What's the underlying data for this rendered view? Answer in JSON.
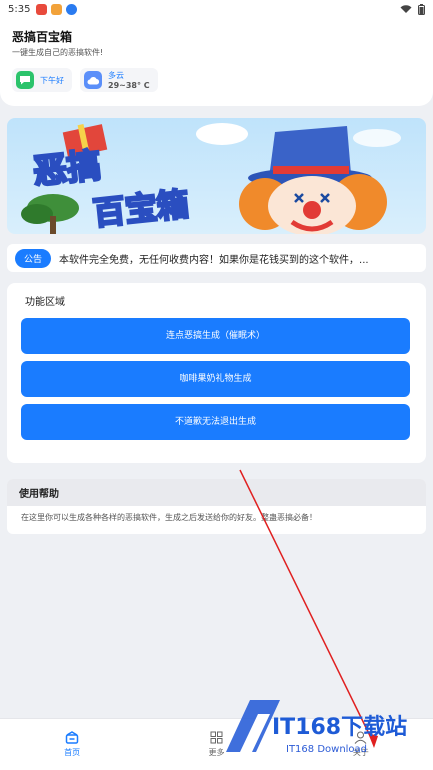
{
  "status_bar": {
    "time": "5:35"
  },
  "header": {
    "title": "恶搞百宝箱",
    "subtitle": "一键生成自己的恶搞软件!",
    "chips": [
      {
        "icon": "chat-icon",
        "color": "#2bc36b",
        "label": "下午好",
        "sub": ""
      },
      {
        "icon": "cloud-icon",
        "color": "#5b8ff9",
        "label": "多云",
        "sub": "29~38° C"
      }
    ]
  },
  "banner": {
    "line1": "恶搞",
    "line2": "百宝箱"
  },
  "notice": {
    "badge": "公告",
    "text": "本软件完全免费，无任何收费内容！如果你是花钱买到的这个软件，..."
  },
  "functions": {
    "title": "功能区域",
    "buttons": [
      "连点恶搞生成（催眠术）",
      "咖啡果奶礼物生成",
      "不道歉无法退出生成"
    ]
  },
  "help": {
    "title": "使用帮助",
    "text": "在这里你可以生成各种各样的恶搞软件，生成之后发送给你的好友。整蛊恶搞必备！"
  },
  "nav": [
    {
      "label": "首页",
      "icon": "home-icon",
      "active": true
    },
    {
      "label": "更多",
      "icon": "grid-icon",
      "active": false
    },
    {
      "label": "关于",
      "icon": "user-icon",
      "active": false
    }
  ],
  "watermark": {
    "logo": "IT168下载站",
    "sub": "IT168 Download"
  },
  "colors": {
    "accent": "#1a7cff",
    "background": "#eef0f4"
  }
}
